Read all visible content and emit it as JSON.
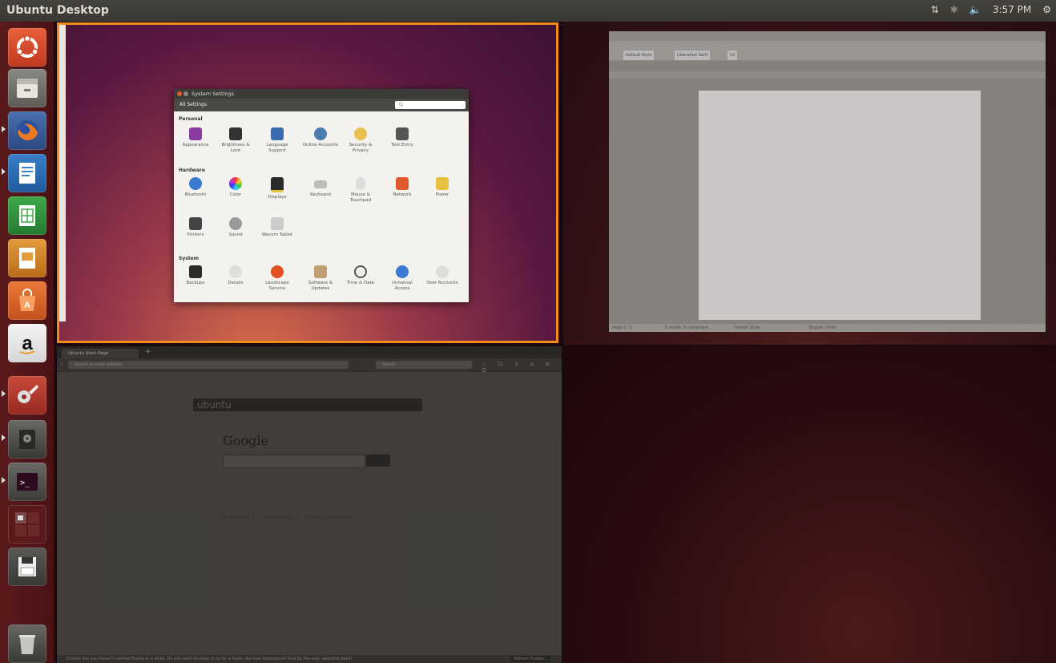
{
  "topbar": {
    "title": "Ubuntu Desktop",
    "network_icon": "network-updown-icon",
    "bluetooth_icon": "bluetooth-icon",
    "sound_icon": "volume-icon",
    "time": "3:57 PM"
  },
  "launcher": {
    "items": [
      {
        "name": "dash-home",
        "icon": "ubuntu-logo-icon"
      },
      {
        "name": "files",
        "icon": "files-icon"
      },
      {
        "name": "firefox",
        "icon": "firefox-icon"
      },
      {
        "name": "writer",
        "icon": "libreoffice-writer-icon"
      },
      {
        "name": "calc",
        "icon": "libreoffice-calc-icon"
      },
      {
        "name": "impress",
        "icon": "libreoffice-impress-icon"
      },
      {
        "name": "software-center",
        "icon": "software-center-icon"
      },
      {
        "name": "amazon",
        "icon": "amazon-icon"
      },
      {
        "name": "system-settings",
        "icon": "system-settings-icon"
      },
      {
        "name": "system-monitor",
        "icon": "disk-utility-icon"
      },
      {
        "name": "terminal",
        "icon": "terminal-icon"
      },
      {
        "name": "workspace-switcher",
        "icon": "workspace-switcher-icon"
      },
      {
        "name": "save",
        "icon": "floppy-disk-icon"
      },
      {
        "name": "trash",
        "icon": "trash-icon"
      }
    ]
  },
  "settings": {
    "window_title": "System Settings",
    "all_settings": "All Settings",
    "search_placeholder": "Q",
    "sections": {
      "personal": "Personal",
      "hardware": "Hardware",
      "system": "System"
    },
    "personal": [
      "Appearance",
      "Brightness & Lock",
      "Language Support",
      "Online Accounts",
      "Security & Privacy",
      "Text Entry"
    ],
    "hardware": [
      "Bluetooth",
      "Color",
      "Displays",
      "Keyboard",
      "Mouse & Touchpad",
      "Network",
      "Power",
      "Printers",
      "Sound",
      "Wacom Tablet"
    ],
    "system": [
      "Backups",
      "Details",
      "Landscape Service",
      "Software & Updates",
      "Time & Date",
      "Universal Access",
      "User Accounts"
    ]
  },
  "writer": {
    "style": "Default Style",
    "font": "Liberation Serif",
    "size": "12",
    "status_page": "Page 1 / 1",
    "status_words": "0 words, 0 characters",
    "status_style": "Default Style",
    "status_lang": "English (USA)"
  },
  "firefox": {
    "tab_title": "Ubuntu Start Page",
    "url_placeholder": "Search or enter address",
    "search_placeholder": "Search",
    "ubuntu_bar": "ubuntu",
    "google": "Google",
    "links": [
      "Ubuntu help »",
      "Ubuntu shop »",
      "Ubuntu community »"
    ],
    "notification": "It looks like you haven't started Firefox in a while. Do you want to clean it up for a fresh, like-new experience? And by the way, welcome back!",
    "refresh_button": "Refresh Firefox..."
  }
}
